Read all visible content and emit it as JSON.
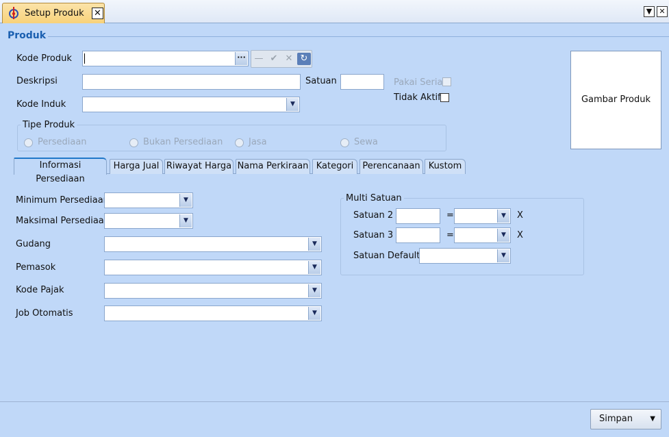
{
  "window": {
    "tab_title": "Setup Produk",
    "close_glyph": "✕",
    "menu_glyph": "▼",
    "win_close_glyph": "✕"
  },
  "section": {
    "title": "Produk"
  },
  "fields": {
    "kode_produk": {
      "label": "Kode Produk",
      "value": ""
    },
    "deskripsi": {
      "label": "Deskripsi",
      "value": ""
    },
    "satuan": {
      "label": "Satuan",
      "value": ""
    },
    "kode_induk": {
      "label": "Kode Induk",
      "value": ""
    }
  },
  "toolstrip": {
    "minus": "—",
    "check": "✔",
    "cross": "✕",
    "refresh": "↻"
  },
  "ellipsis": "···",
  "checks": {
    "pakai_serial": {
      "label": "Pakai Serial",
      "checked": false,
      "disabled": true
    },
    "tidak_aktif": {
      "label": "Tidak Aktif",
      "checked": false
    }
  },
  "image_box": {
    "label": "Gambar Produk"
  },
  "tipe_produk": {
    "legend": "Tipe Produk",
    "options": [
      "Persediaan",
      "Bukan Persediaan",
      "Jasa",
      "Sewa"
    ]
  },
  "tabs": [
    "Informasi Persediaan",
    "Harga Jual",
    "Riwayat Harga",
    "Nama Perkiraan",
    "Kategori",
    "Perencanaan",
    "Kustom"
  ],
  "persediaan": {
    "minimum": "Minimum Persediaan",
    "maksimal": "Maksimal Persediaan",
    "gudang": "Gudang",
    "pemasok": "Pemasok",
    "kode_pajak": "Kode Pajak",
    "job_otomatis": "Job Otomatis"
  },
  "multi_satuan": {
    "legend": "Multi Satuan",
    "satuan2": "Satuan 2",
    "satuan3": "Satuan 3",
    "satuan_default": "Satuan Default",
    "equals": "=",
    "times": "X"
  },
  "footer": {
    "simpan": "Simpan"
  },
  "colors": {
    "background": "#c0d8f8",
    "accent": "#1a5fb0",
    "active_tab": "#f8d27a"
  }
}
